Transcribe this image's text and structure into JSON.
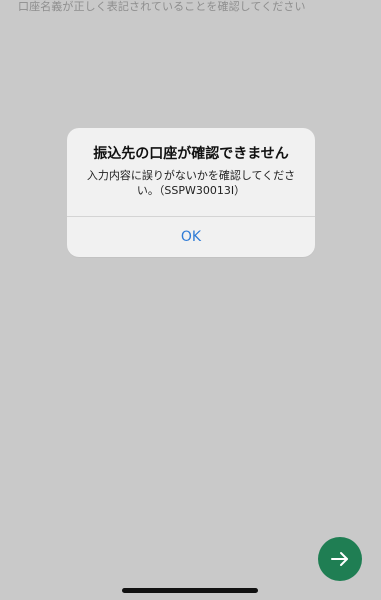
{
  "screen": {
    "instruction_text": "口座名義が正しく表記されていることを確認してください"
  },
  "alert": {
    "title": "振込先の口座が確認できません",
    "message": "入力内容に誤りがないかを確認してください。（SSPW30013I）",
    "ok_label": "OK"
  },
  "next_button": {
    "icon": "arrow-right-icon"
  },
  "colors": {
    "accent_green": "#1f7e53",
    "link_blue": "#2f7bd6",
    "overlay_gray": "#c9c9c9"
  }
}
